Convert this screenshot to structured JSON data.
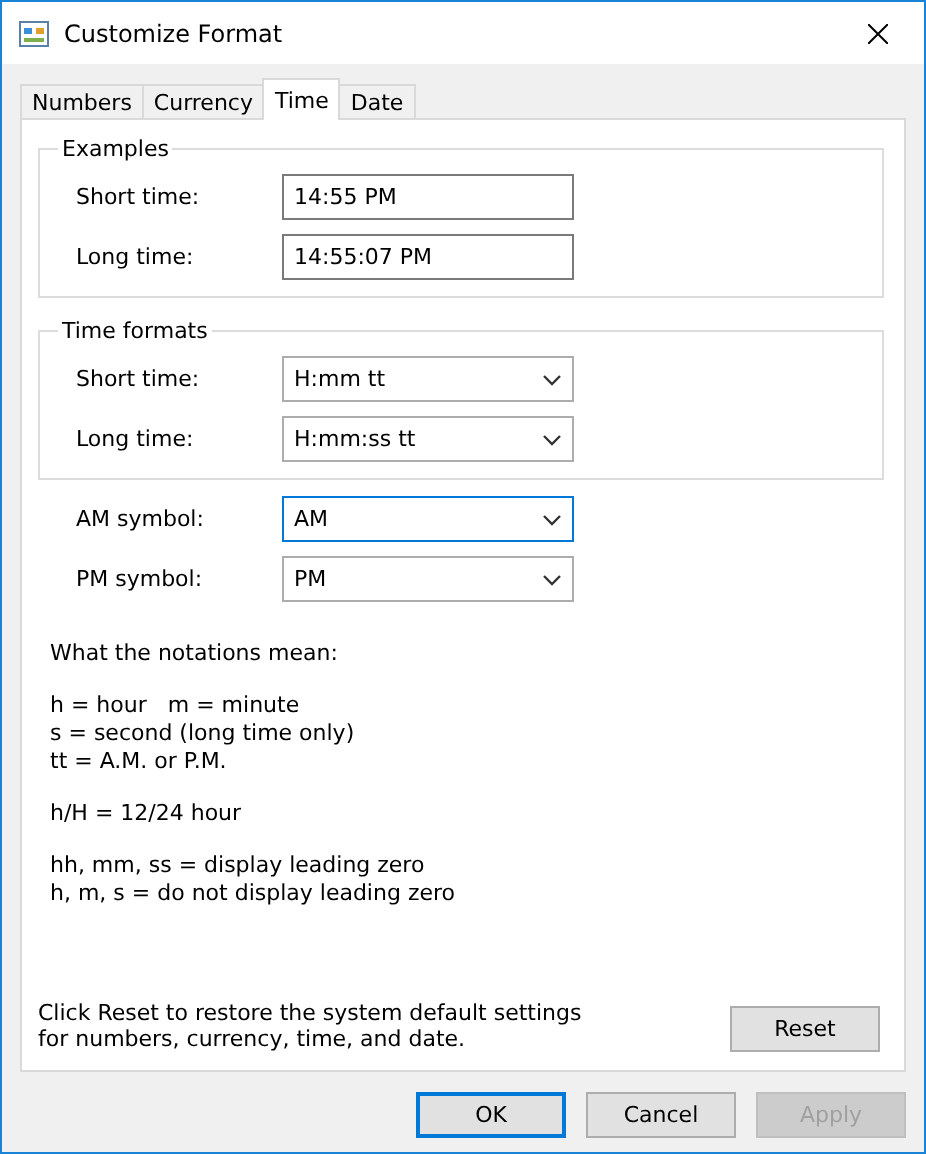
{
  "window": {
    "title": "Customize Format"
  },
  "tabs": [
    {
      "label": "Numbers",
      "selected": false
    },
    {
      "label": "Currency",
      "selected": false
    },
    {
      "label": "Time",
      "selected": true
    },
    {
      "label": "Date",
      "selected": false
    }
  ],
  "examples": {
    "title": "Examples",
    "rows": [
      {
        "label": "Short time:",
        "value": "14:55 PM"
      },
      {
        "label": "Long time:",
        "value": "14:55:07 PM"
      }
    ]
  },
  "time_formats": {
    "title": "Time formats",
    "rows": [
      {
        "label": "Short time:",
        "value": "H:mm tt",
        "focused": false
      },
      {
        "label": "Long time:",
        "value": "H:mm:ss tt",
        "focused": false
      }
    ]
  },
  "symbols": [
    {
      "label": "AM symbol:",
      "value": "AM",
      "focused": true
    },
    {
      "label": "PM symbol:",
      "value": "PM",
      "focused": false
    }
  ],
  "notes": {
    "heading": "What the notations mean:",
    "groups": [
      [
        "h = hour   m = minute",
        "s = second (long time only)",
        "tt = A.M. or P.M."
      ],
      [
        "h/H = 12/24 hour"
      ],
      [
        "hh, mm, ss = display leading zero",
        "h, m, s = do not display leading zero"
      ]
    ]
  },
  "reset": {
    "text": "Click Reset to restore the system default settings for numbers, currency, time, and date.",
    "button": "Reset"
  },
  "buttons": [
    {
      "label": "OK",
      "disabled": false,
      "default": true
    },
    {
      "label": "Cancel",
      "disabled": false,
      "default": false
    },
    {
      "label": "Apply",
      "disabled": true,
      "default": false
    }
  ]
}
